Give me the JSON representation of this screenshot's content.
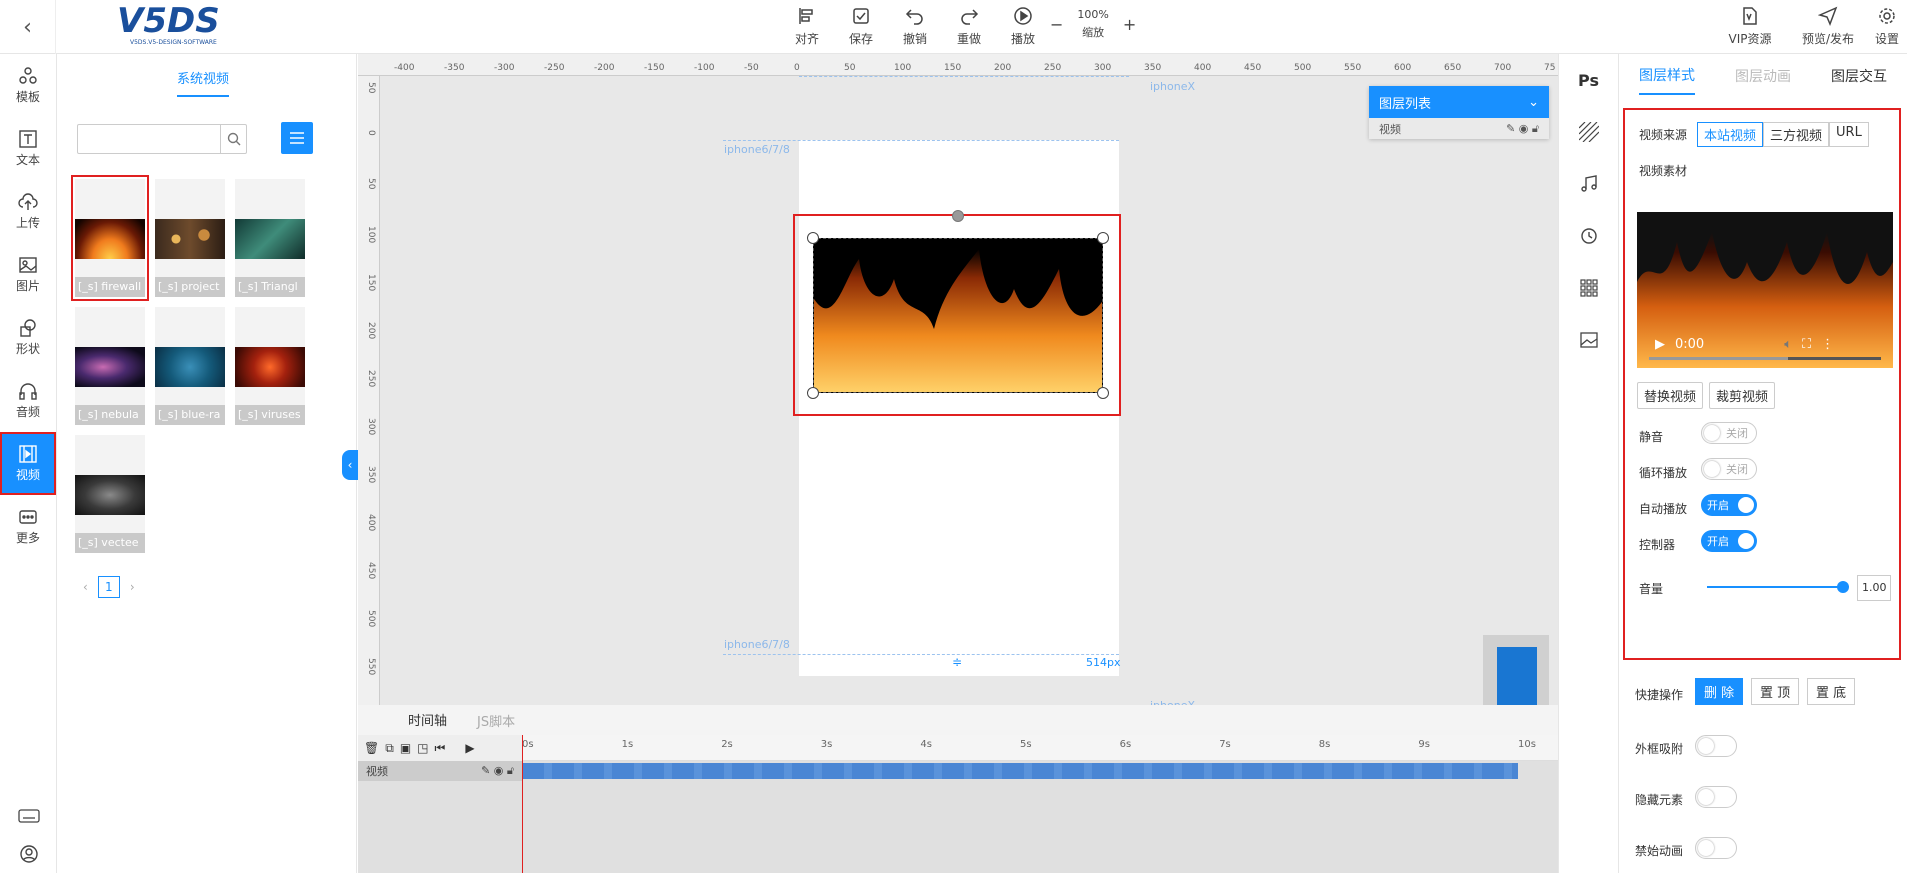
{
  "toolbar": {
    "align": "对齐",
    "save": "保存",
    "undo": "撤销",
    "redo": "重做",
    "play": "播放",
    "zoom_value": "100%",
    "zoom_label": "缩放",
    "zoom_out": "−",
    "zoom_in": "+",
    "vip": "VIP资源",
    "preview": "预览/发布",
    "settings": "设置"
  },
  "logo_text": "V5DS",
  "logo_sub": "V5DS.V5-DESIGN-SOFTWARE",
  "nav": [
    "模板",
    "文本",
    "上传",
    "图片",
    "形状",
    "音频",
    "视频",
    "更多"
  ],
  "panel": {
    "tab": "系统视频",
    "search_placeholder": "",
    "items": [
      "[_s] firewall",
      "[_s] project",
      "[_s] Triangl",
      "[_s] nebula",
      "[_s] blue-ra",
      "[_s] viruses",
      "[_s] vectee"
    ],
    "page": "1"
  },
  "ruler": {
    "h": [
      "-400",
      "-350",
      "-300",
      "-250",
      "-200",
      "-150",
      "-100",
      "-50",
      "0",
      "50",
      "100",
      "150",
      "200",
      "250",
      "300",
      "350",
      "400",
      "450",
      "500",
      "550",
      "600",
      "650",
      "700",
      "75"
    ],
    "v": [
      "50",
      "0",
      "50",
      "100",
      "150",
      "200",
      "250",
      "300",
      "350",
      "400",
      "450",
      "500",
      "550"
    ]
  },
  "canvas": {
    "guide_top": "iphoneX",
    "guide_top_left": "iphone6/7/8",
    "guide_bottom_left": "iphone6/7/8",
    "guide_bottom": "iphoneX",
    "height_label": "514px"
  },
  "layer_list": {
    "title": "图层列表",
    "row": "视频"
  },
  "timeline": {
    "tab_active": "时间轴",
    "tab_other": "JS脚本",
    "track": "视频",
    "seconds": [
      "0s",
      "1s",
      "2s",
      "3s",
      "4s",
      "5s",
      "6s",
      "7s",
      "8s",
      "9s",
      "10s"
    ]
  },
  "props": {
    "tabs": [
      "图层样式",
      "图层动画",
      "图层交互"
    ],
    "source_label": "视频来源",
    "source_options": [
      "本站视频",
      "三方视频",
      "URL"
    ],
    "material_label": "视频素材",
    "video_time": "0:00",
    "replace": "替换视频",
    "crop": "裁剪视频",
    "mute_label": "静音",
    "mute_state": "关闭",
    "loop_label": "循环播放",
    "loop_state": "关闭",
    "autoplay_label": "自动播放",
    "autoplay_state": "开启",
    "controls_label": "控制器",
    "controls_state": "开启",
    "volume_label": "音量",
    "volume_value": "1.00",
    "quick_label": "快捷操作",
    "delete": "删 除",
    "top": "置 顶",
    "bottom": "置 底",
    "snap_label": "外框吸附",
    "hide_label": "隐藏元素",
    "noanim_label": "禁始动画"
  },
  "accent": "#1890ff",
  "highlight": "#e02020"
}
